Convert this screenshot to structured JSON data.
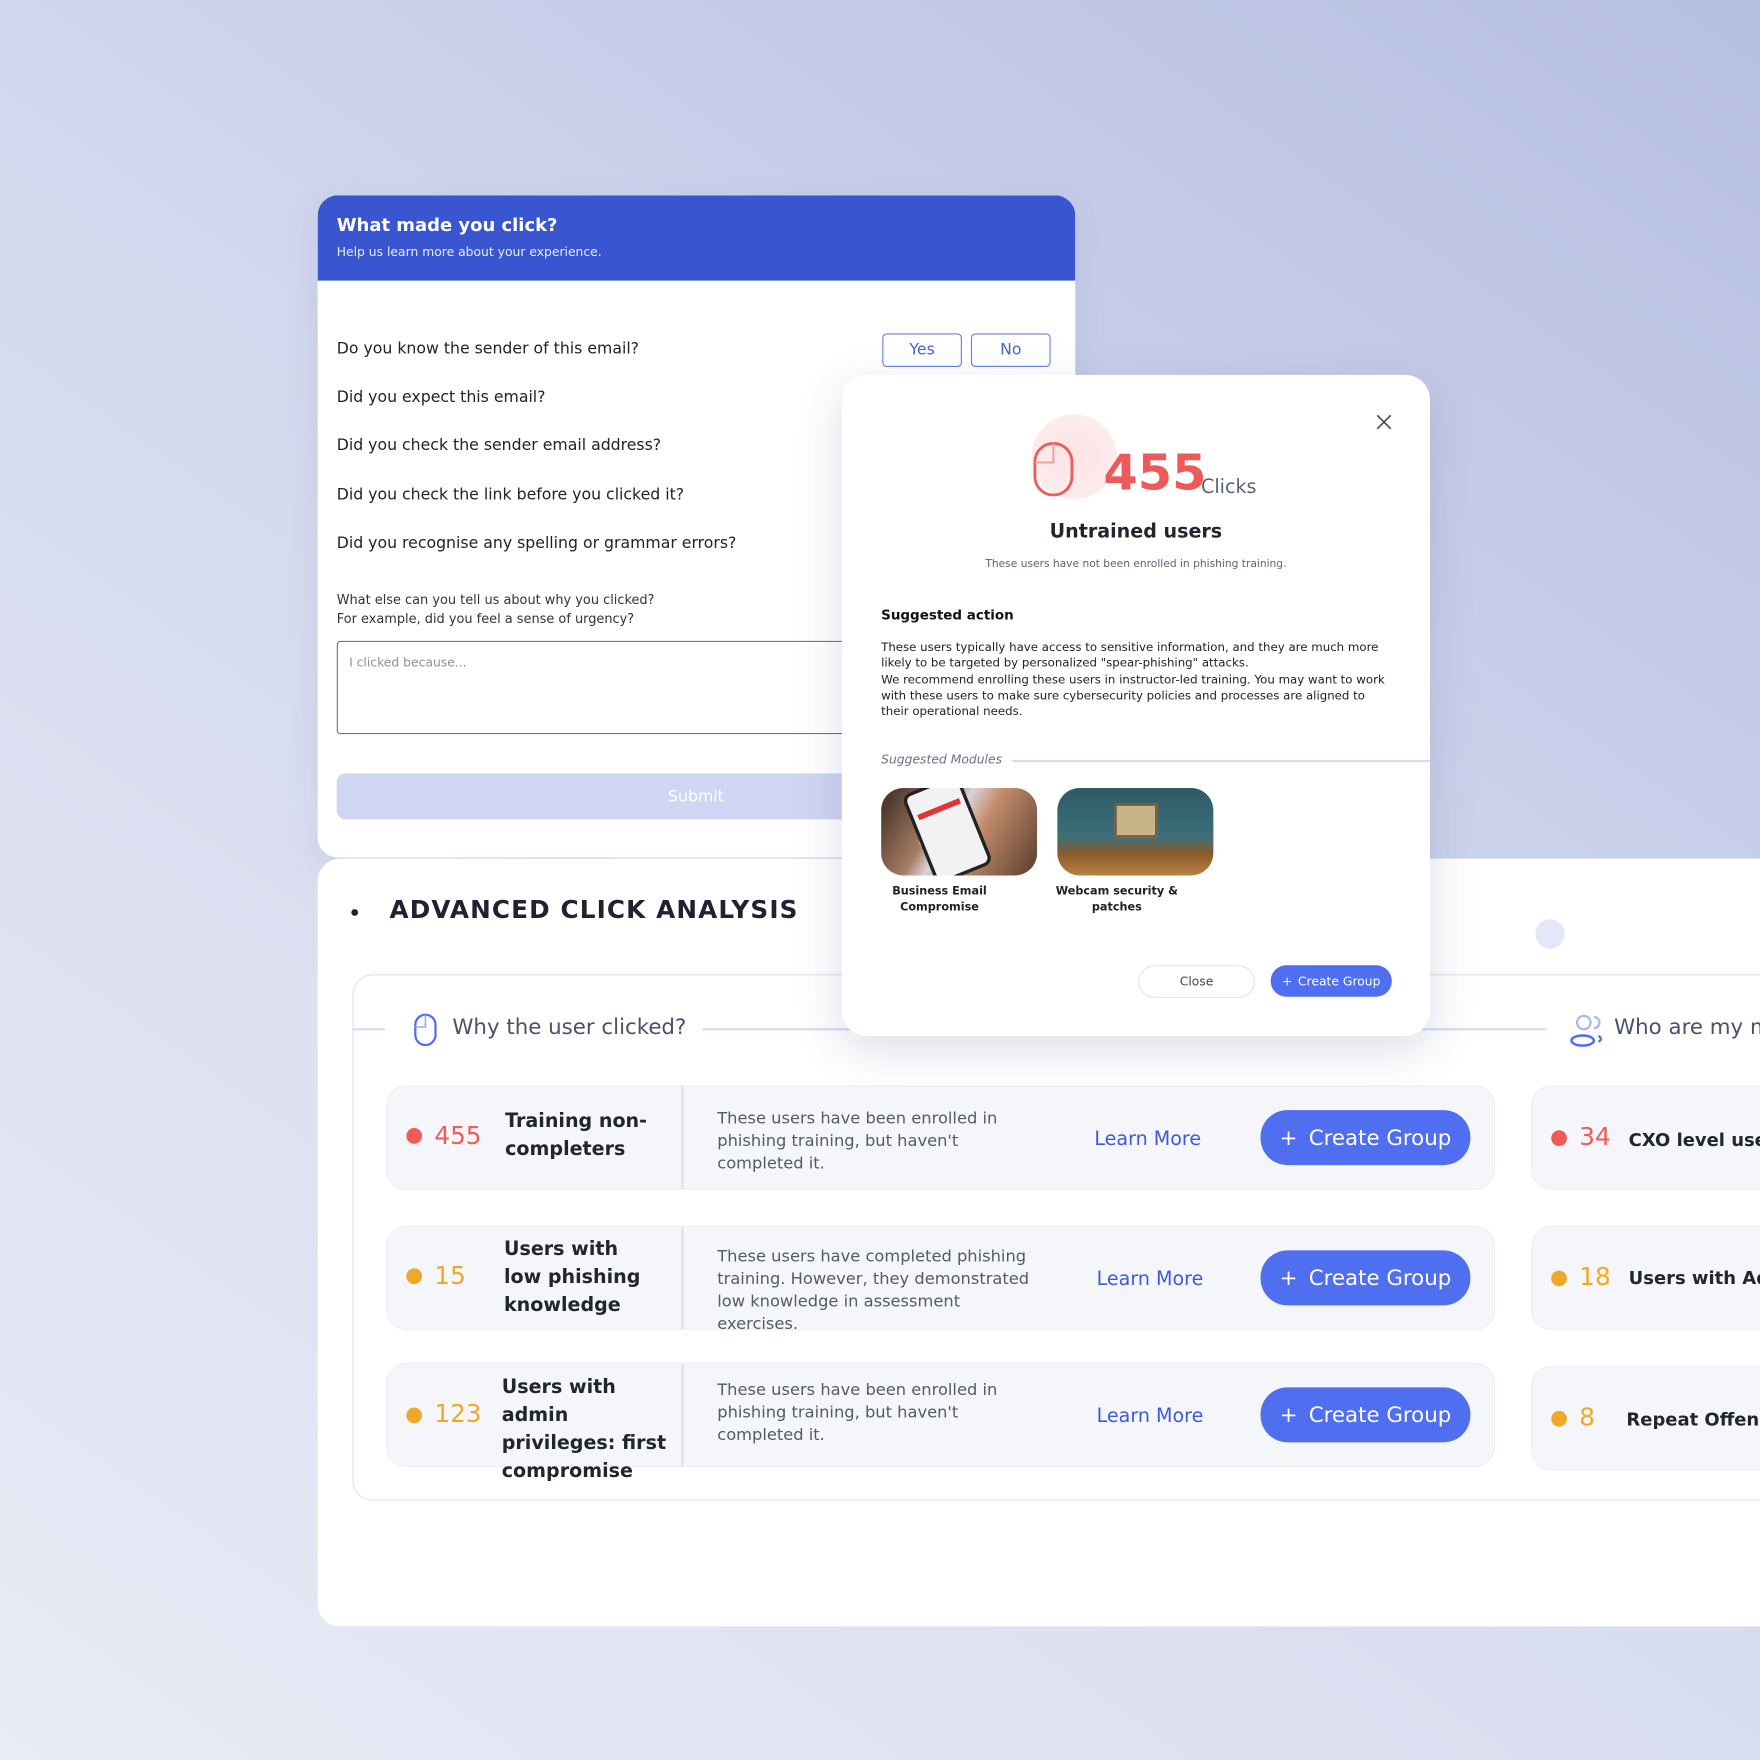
{
  "survey": {
    "title": "What made you click?",
    "subtitle": "Help us learn more about your experience.",
    "questions": [
      "Do you know the sender of this email?",
      "Did you expect this email?",
      "Did you check the sender email address?",
      "Did you check the link before you clicked it?",
      "Did you recognise any spelling or grammar errors?"
    ],
    "yes_label": "Yes",
    "no_label": "No",
    "free_text_prompt_1": "What else can you tell us about why you clicked?",
    "free_text_prompt_2": "For example, did you feel a sense of urgency?",
    "textarea_placeholder": "I clicked because...",
    "submit_label": "Submit"
  },
  "analysis": {
    "title": "ADVANCED CLICK ANALYSIS",
    "why_section": "Why the user clicked?",
    "who_section": "Who are my m",
    "learn_more": "Learn More",
    "create_group": "Create Group",
    "rows": [
      {
        "count": "455",
        "label": "Training non-completers",
        "desc": "These users have been enrolled in phishing training, but haven't completed it.",
        "severity": "#f25a5a"
      },
      {
        "count": "15",
        "label": "Users with low phishing knowledge",
        "desc": "These users have completed phishing training. However, they demonstrated low knowledge in assessment exercises.",
        "severity": "#f0a82a"
      },
      {
        "count": "123",
        "label": "Users with admin privileges: first compromise",
        "desc": "These users have been enrolled in phishing training, but haven't completed it.",
        "severity": "#f0a82a"
      }
    ],
    "right_rows": [
      {
        "count": "34",
        "label": "CXO level users",
        "severity": "#f25a5a"
      },
      {
        "count": "18",
        "label": "Users with Adm",
        "severity": "#f0a82a"
      },
      {
        "count": "8",
        "label": "Repeat Offende",
        "severity": "#f0a82a"
      }
    ]
  },
  "modal": {
    "count": "455",
    "count_unit": "Clicks",
    "title": "Untrained users",
    "subtitle": "These users have not been enrolled in phishing training.",
    "action_heading": "Suggested action",
    "action_p1": "These users typically have access to sensitive information, and they are much more likely to be targeted by personalized \"spear-phishing\" attacks.",
    "action_p2": "We recommend enrolling these users in instructor-led training. You may want to work with these users to make sure cybersecurity policies and processes are aligned to their operational needs.",
    "modules_heading": "Suggested Modules",
    "modules": [
      "Business Email Compromise",
      "Webcam security & patches"
    ],
    "close_label": "Close",
    "create_label": "Create Group"
  },
  "colors": {
    "primary": "#3a55d0",
    "button": "#4f6ef0",
    "red": "#f25a5a",
    "amber": "#f0a82a"
  }
}
